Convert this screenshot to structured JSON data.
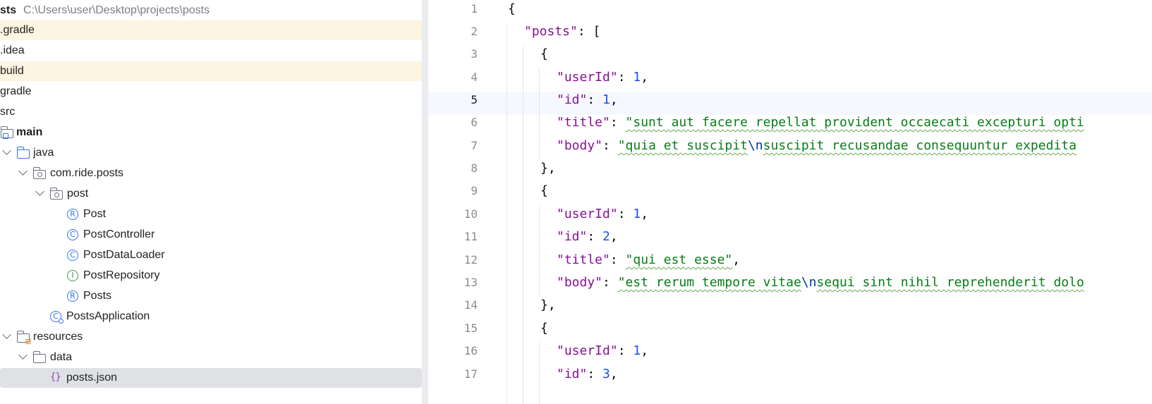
{
  "project": {
    "root_name": "sts",
    "root_path": "C:\\Users\\user\\Desktop\\projects\\posts"
  },
  "tree": {
    "gradle_hidden": ".gradle",
    "idea": ".idea",
    "build": "build",
    "gradle": "gradle",
    "src": "src",
    "main": "main",
    "java": "java",
    "package": "com.ride.posts",
    "post": "post",
    "Post": "Post",
    "PostController": "PostController",
    "PostDataLoader": "PostDataLoader",
    "PostRepository": "PostRepository",
    "Posts": "Posts",
    "PostsApplication": "PostsApplication",
    "resources": "resources",
    "data": "data",
    "posts_json": "posts.json"
  },
  "icons": {
    "record": "R",
    "class": "C",
    "interface": "I",
    "json": "{}"
  },
  "editor": {
    "line_numbers": [
      "1",
      "2",
      "3",
      "4",
      "5",
      "6",
      "7",
      "8",
      "9",
      "10",
      "11",
      "12",
      "13",
      "14",
      "15",
      "16",
      "17"
    ],
    "current_line": "5",
    "punct": {
      "open_brace": "{",
      "close_brace_comma": "},",
      "colon": ": ",
      "comma": ",",
      "open_bracket": "[",
      "newline_escape": "\\n"
    },
    "keys": {
      "posts": "\"posts\"",
      "userId": "\"userId\"",
      "id": "\"id\"",
      "title": "\"title\"",
      "body": "\"body\""
    },
    "values": {
      "one": "1",
      "two": "2",
      "three": "3",
      "title1": "\"sunt aut facere repellat provident occaecati excepturi opti",
      "body1_a": "\"quia et suscipit",
      "body1_b": "suscipit recusandae consequuntur expedita",
      "title2": "\"qui est esse\"",
      "body2_a": "\"est rerum tempore vitae",
      "body2_b": "sequi sint nihil reprehenderit dolo"
    }
  },
  "colors": {
    "json_key": "#871094",
    "json_string": "#067d17",
    "json_number": "#1750eb",
    "excluded_bg": "#fdf4e1",
    "selected_bg": "#dfe1e5"
  }
}
